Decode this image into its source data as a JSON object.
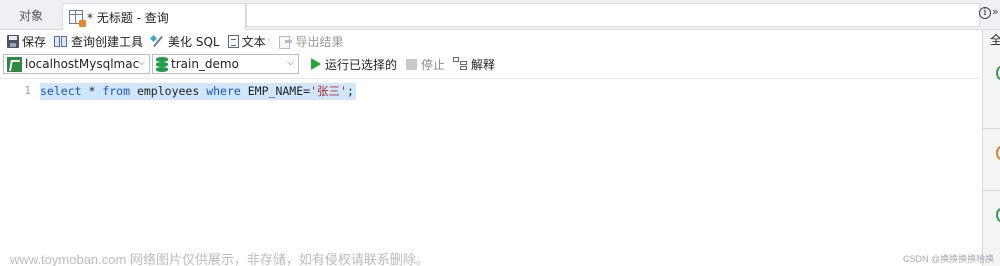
{
  "tabs": {
    "objects_label": "对象",
    "query_tab_title": "* 无标题 - 查询"
  },
  "toolbar": {
    "save_label": "保存",
    "query_builder_label": "查询创建工具",
    "beautify_label": "美化 SQL",
    "text_label": "文本",
    "text_caret": "·",
    "export_label": "导出结果"
  },
  "connection": {
    "connection_name": "localhostMysqlmac",
    "database_name": "train_demo",
    "run_selected_label": "运行已选择的",
    "stop_label": "停止",
    "explain_label": "解释"
  },
  "editor": {
    "line_number": "1",
    "tokens": {
      "select": "select",
      "star": " * ",
      "from": "from",
      "table": " employees ",
      "where": "where",
      "condition": " EMP_NAME=",
      "value": "'张三'",
      "terminator": ";"
    }
  },
  "side_panel": {
    "label": "全"
  },
  "watermark": {
    "left_text": "www.toymoban.com 网络图片仅供展示，非存储，如有侵权请联系删除。",
    "right_text": "CSDN @换换换换啥换"
  },
  "colors": {
    "keyword": "#1b55c9",
    "string": "#b02b2b",
    "selection": "#cfe6fb",
    "run_green": "#22a63a"
  },
  "icons": {
    "tab": "query-table-icon",
    "save": "save-icon",
    "builder": "query-builder-icon",
    "beautify": "beautify-brush-icon",
    "text": "text-document-icon",
    "export": "export-icon",
    "connection": "mysql-connection-icon",
    "database": "database-icon",
    "run": "play-icon",
    "stop": "stop-icon",
    "explain": "explain-icon"
  }
}
